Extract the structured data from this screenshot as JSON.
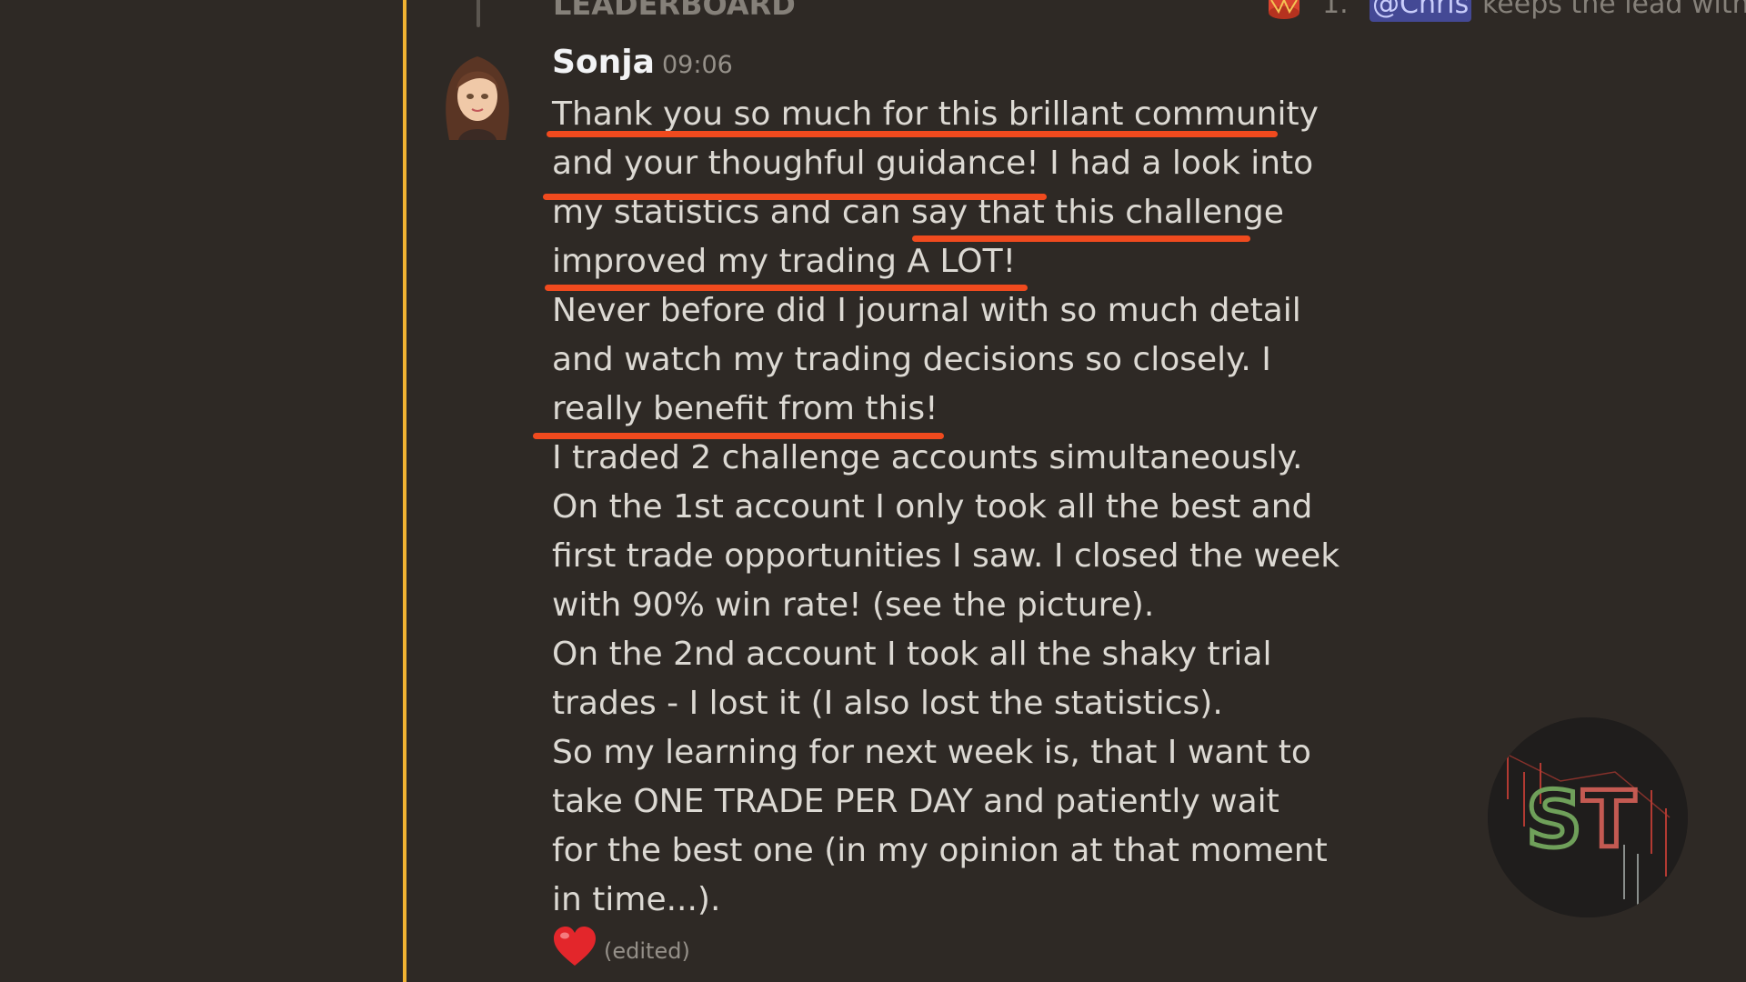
{
  "reply": {
    "title": "LEADERBOARD",
    "emoji": "drum-emoji",
    "number": "1.",
    "mention": "@Chris",
    "preview": "keeps the lead with ..."
  },
  "message": {
    "author": "Sonja",
    "time": "09:06",
    "lines": [
      "Thank you so much for this brillant community",
      "and your thoughful guidance! I had a look into",
      "my statistics and can say that this challenge",
      "improved my trading A LOT!",
      "Never before did I journal with so much detail",
      "and watch my trading decisions so closely. I",
      "really benefit from this!",
      "I traded 2 challenge accounts simultaneously.",
      "On the 1st account I only took all the best and",
      "first trade opportunities I saw. I closed the week",
      "with 90% win rate! (see the picture).",
      "On the 2nd account I took all the shaky trial",
      "trades - I lost it (I also lost the statistics).",
      "So my learning for next week is, that I want to",
      "take ONE TRADE PER DAY and patiently wait",
      "for the best one (in my opinion at that moment",
      "in time...)."
    ],
    "reaction": "heart-emoji",
    "edited_label": "(edited)"
  },
  "logo": {
    "text": "ST",
    "colors": {
      "s": "#6fa05a",
      "t": "#c45a52"
    }
  },
  "colors": {
    "background": "#2e2925",
    "accent": "#f0b232",
    "underline": "#f04a1e",
    "mention_bg": "#5865f2"
  }
}
